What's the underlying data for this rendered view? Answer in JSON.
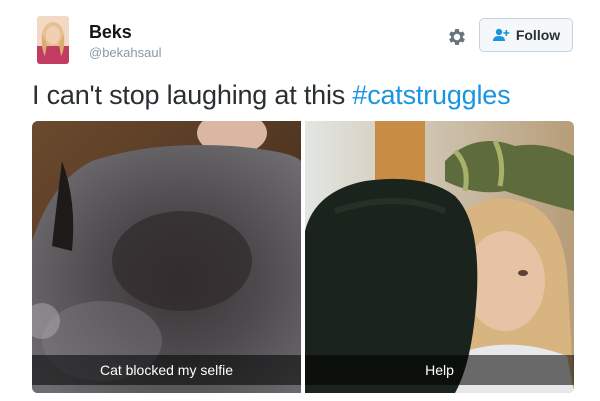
{
  "user": {
    "name": "Beks",
    "handle": "@bekahsaul",
    "avatar_icon": "profile-photo"
  },
  "actions": {
    "settings_icon": "gear-icon",
    "follow_icon": "add-user-icon",
    "follow_label": "Follow"
  },
  "tweet": {
    "text": "I can't stop laughing at this ",
    "hashtag": "#catstruggles"
  },
  "media": {
    "photos": [
      {
        "caption": "Cat blocked my selfie"
      },
      {
        "caption": "Help"
      }
    ]
  },
  "colors": {
    "link": "#1b95e0",
    "text": "#292f33",
    "muted": "#8899a6"
  }
}
